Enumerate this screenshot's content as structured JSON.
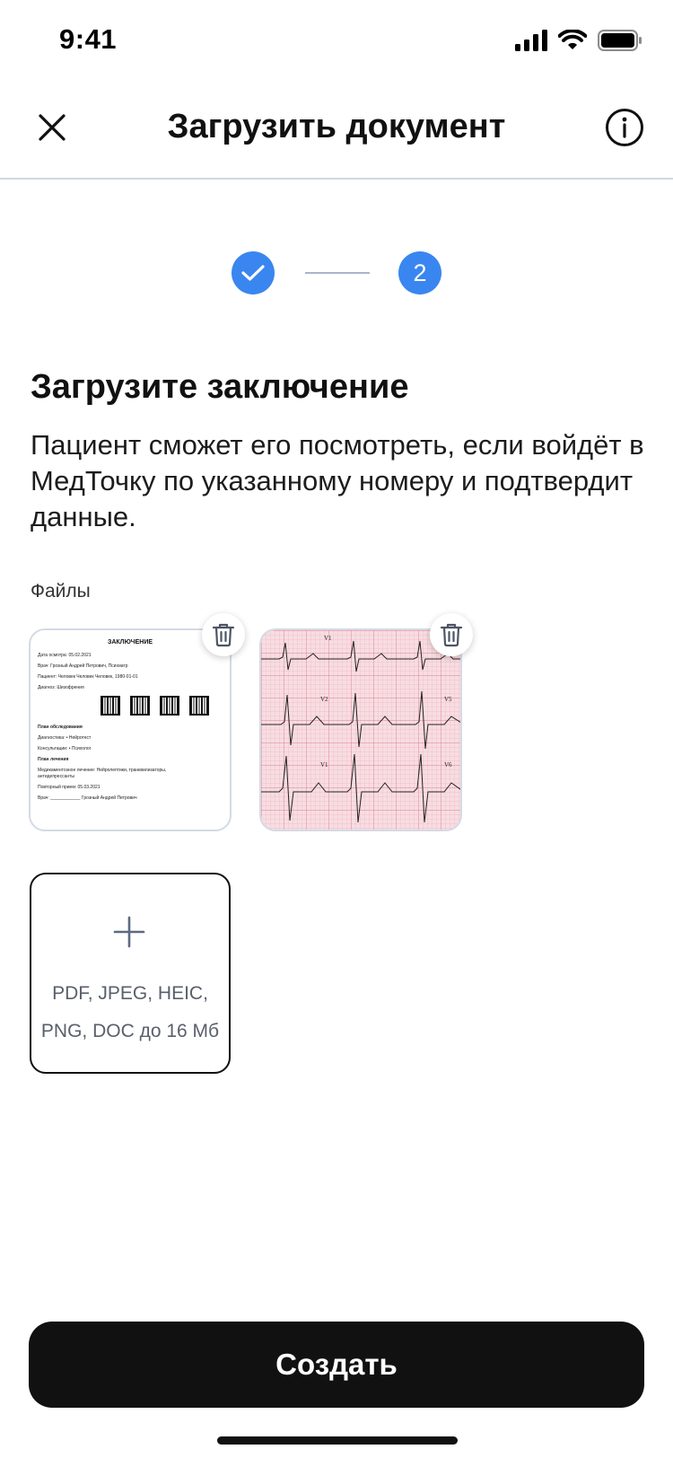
{
  "status_bar": {
    "time": "9:41"
  },
  "nav": {
    "title": "Загрузить документ"
  },
  "stepper": {
    "current_step": "2"
  },
  "content": {
    "heading": "Загрузите заключение",
    "description": "Пациент сможет его посмотреть, если войдёт в МедТочку по указанному номеру и подтвердит данные.",
    "files_label": "Файлы"
  },
  "document_preview": {
    "title": "ЗАКЛЮЧЕНИЕ",
    "lines": [
      "Дата осмотра: 05.02.2021",
      "Врач: Грозный Андрей Петрович, Психиатр",
      "Пациент: Человек Человек Человек, 1980-01-01",
      "Диагноз: Шизофрения",
      "План обследования",
      "Диагностика: • Нейротест",
      "Консультации: • Психолог",
      "План лечения",
      "Медикаментозное лечение: Нейролептики, транквилизаторы, антидепрессанты",
      "Повторный прием: 05.03.2021",
      "Врач: ____________  Грозный Андрей Петрович"
    ]
  },
  "ecg_preview": {
    "leads": [
      "V1",
      "V2",
      "V1",
      "V5",
      "V6"
    ]
  },
  "add_file": {
    "formats_line1": "PDF, JPEG, HEIC,",
    "formats_line2": "PNG, DOC до 16 Мб"
  },
  "footer": {
    "create_label": "Создать"
  },
  "colors": {
    "accent": "#3a86f0",
    "primary_button": "#111111",
    "border": "#d4dae5"
  },
  "icons": {
    "close": "close-icon",
    "info": "info-icon",
    "check": "check-icon",
    "trash": "trash-icon",
    "plus": "plus-icon"
  }
}
